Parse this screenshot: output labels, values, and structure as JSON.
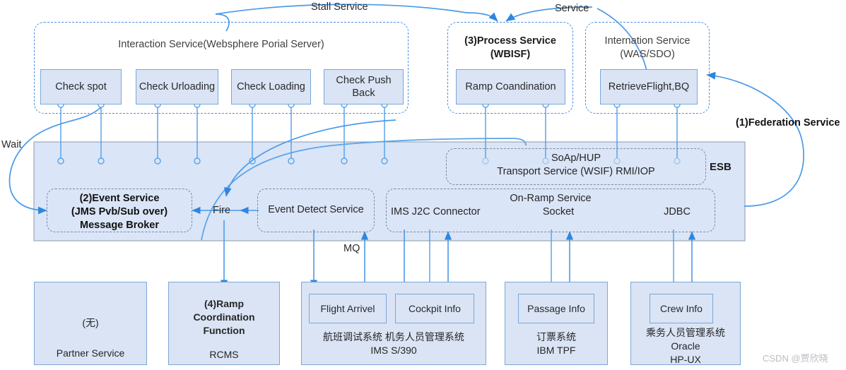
{
  "diagram": {
    "title_watermark": "CSDN @贾欣晓",
    "accent_color": "#4a90e2",
    "box_fill": "#dae4f5",
    "band_fill": "#dae5f7"
  },
  "top_groups": [
    {
      "id": "interaction-service",
      "title": "Interaction Service(Websphere Porial Server)",
      "bold": false,
      "boxes": [
        {
          "label": "Check spot"
        },
        {
          "label": "Check Urloading"
        },
        {
          "label": "Check Loading"
        },
        {
          "label": "Check Push\nBack"
        }
      ]
    },
    {
      "id": "process-service",
      "title": "(3)Process Service\n(WBISF)",
      "bold": true,
      "boxes": [
        {
          "label": "Ramp Coandination"
        }
      ]
    },
    {
      "id": "internation-service",
      "title": "Internation Service\n(WAS/SDO)",
      "bold": false,
      "boxes": [
        {
          "label": "RetrieveFlight,BQ"
        }
      ]
    }
  ],
  "esb": {
    "label": "ESB",
    "event_service": "(2)Event Service\n(JMS Pvb/Sub over)\nMessage Broker",
    "fire_label": "Fire",
    "event_detect": "Event Detect Service",
    "transport": {
      "line1": "SoAp/HUP",
      "line2": "Transport Service (WSIF) RMI/IOP"
    },
    "onramp": {
      "title": "On-Ramp Service",
      "items": [
        "IMS J2C Connector",
        "Socket",
        "JDBC"
      ]
    }
  },
  "edge_labels": [
    {
      "id": "stall-service",
      "text": "Stall Service",
      "bold": false
    },
    {
      "id": "service",
      "text": "Service",
      "bold": false
    },
    {
      "id": "federation-service",
      "text": "(1)Federation Service",
      "bold": true
    },
    {
      "id": "wait",
      "text": "Wait",
      "bold": false
    },
    {
      "id": "mq",
      "text": "MQ",
      "bold": false
    }
  ],
  "bottom_systems": [
    {
      "id": "partner-service",
      "center_text": "(无)",
      "caption": "Partner Service",
      "inner_boxes": []
    },
    {
      "id": "rcms",
      "center_text": "(4)Ramp\nCoordination\nFunction",
      "caption": "RCMS",
      "inner_boxes": []
    },
    {
      "id": "ims-s390",
      "center_text": "",
      "caption": "航班调试系统  机务人员管理系统\nIMS S/390",
      "inner_boxes": [
        {
          "label": "Flight Arrivel"
        },
        {
          "label": "Cockpit Info"
        }
      ]
    },
    {
      "id": "ibm-tpf",
      "center_text": "",
      "caption": "订票系统\nIBM TPF",
      "inner_boxes": [
        {
          "label": "Passage Info"
        }
      ]
    },
    {
      "id": "oracle-hpux",
      "center_text": "",
      "caption": "乘务人员管理系统\nOracle\nHP-UX",
      "inner_boxes": [
        {
          "label": "Crew Info"
        }
      ]
    }
  ]
}
